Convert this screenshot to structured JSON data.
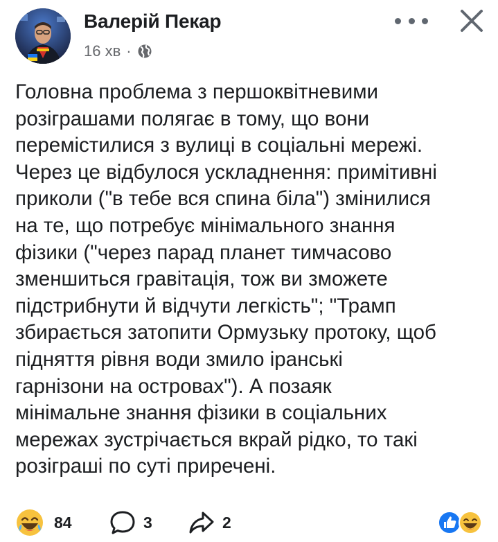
{
  "post": {
    "author": "Валерій Пекар",
    "time": "16 хв",
    "separator": "·",
    "privacy_icon": "globe-icon",
    "text": "Головна проблема з першоквітневими\nрозіграшами полягає в тому, що вони\nперемістилися з вулиці в соціальні мережі.\nЧерез це відбулося ускладнення: примітивні\nприколи (\"в тебе вся спина біла\") змінилися\nна те, що потребує мінімального знання\nфізики (\"через парад планет тимчасово\nзменшиться гравітація, тож ви зможете\nпідстрибнути й відчути легкість\"; \"Трамп\nзбирається затопити Ормузьку протоку, щоб\nпідняття рівня води змило іранські\nгарнізони на островах\"). А позаяк\nмінімальне знання фізики в соціальних\nмережах зустрічається вкрай рідко, то такі\nрозіграші по суті приречені."
  },
  "header_icons": {
    "more": "more-horizontal-icon",
    "close": "close-icon"
  },
  "footer": {
    "reactions": {
      "icon": "laughing-emoji-icon",
      "count": "84"
    },
    "comments": {
      "icon": "comment-icon",
      "count": "3"
    },
    "shares": {
      "icon": "share-icon",
      "count": "2"
    },
    "reaction_summary": [
      "like-icon",
      "laughing-emoji-icon"
    ]
  },
  "colors": {
    "text": "#1c1e21",
    "secondary": "#65676b",
    "like_blue": "#1877f2",
    "emoji_yellow": "#f7c23e"
  }
}
